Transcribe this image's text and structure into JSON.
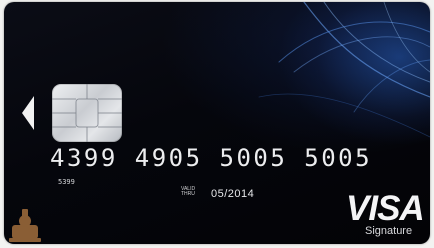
{
  "card": {
    "brand": "VISA",
    "tier": "Signature",
    "number": "4399 4905 5005 5005",
    "small_code": "5399",
    "valid_thru_label": "VALID THRU",
    "expiry": "05/2014"
  },
  "colors": {
    "card_background": "#05060c",
    "swirl_blue": "#4a8fe0",
    "text": "#ecedef"
  },
  "icons": [
    "chip-icon",
    "left-arrow-icon",
    "emblem-icon"
  ]
}
